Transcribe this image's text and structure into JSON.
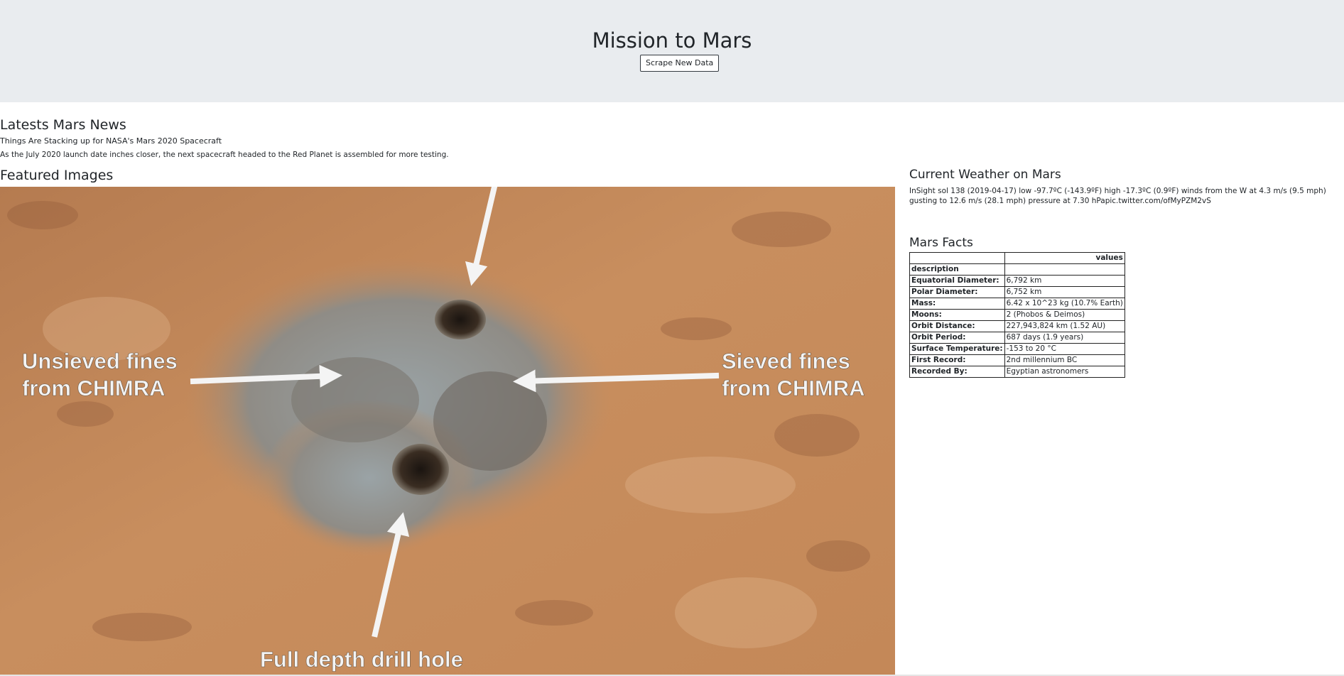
{
  "header": {
    "title": "Mission to Mars",
    "scrape_button": "Scrape New Data"
  },
  "news": {
    "heading": "Latests Mars News",
    "title": "Things Are Stacking up for NASA's Mars 2020 Spacecraft",
    "paragraph": "As the July 2020 launch date inches closer, the next spacecraft headed to the Red Planet is assembled for more testing."
  },
  "featured": {
    "heading": "Featured Images",
    "labels": {
      "unsieved_line1": "Unsieved fines",
      "unsieved_line2": "from CHIMRA",
      "sieved_line1": "Sieved fines",
      "sieved_line2": "from CHIMRA",
      "drill": "Full depth drill hole"
    }
  },
  "weather": {
    "heading": "Current Weather on Mars",
    "text": "InSight sol 138 (2019-04-17) low -97.7ºC (-143.9ºF) high -17.3ºC (0.9ºF) winds from the W at 4.3 m/s (9.5 mph) gusting to 12.6 m/s (28.1 mph) pressure at 7.30 hPapic.twitter.com/ofMyPZM2vS"
  },
  "facts": {
    "heading": "Mars Facts",
    "values_header": "values",
    "index_header": "description",
    "rows": [
      {
        "label": "Equatorial Diameter:",
        "value": "6,792 km"
      },
      {
        "label": "Polar Diameter:",
        "value": "6,752 km"
      },
      {
        "label": "Mass:",
        "value": "6.42 x 10^23 kg (10.7% Earth)"
      },
      {
        "label": "Moons:",
        "value": "2 (Phobos & Deimos)"
      },
      {
        "label": "Orbit Distance:",
        "value": "227,943,824 km (1.52 AU)"
      },
      {
        "label": "Orbit Period:",
        "value": "687 days (1.9 years)"
      },
      {
        "label": "Surface Temperature:",
        "value": "-153 to 20 °C"
      },
      {
        "label": "First Record:",
        "value": "2nd millennium BC"
      },
      {
        "label": "Recorded By:",
        "value": "Egyptian astronomers"
      }
    ]
  }
}
